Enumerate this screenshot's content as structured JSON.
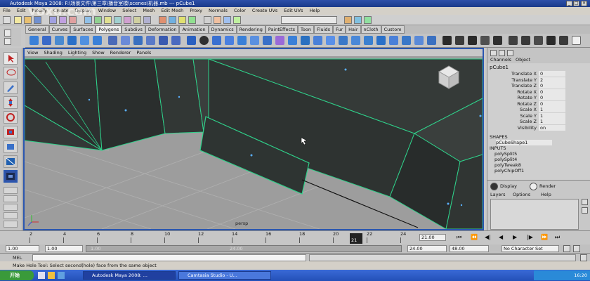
{
  "window": {
    "title": "Autodesk Maya 2008: F:\\场景文件\\第三章\\播音室模\\scenes\\机器.mb   ---   pCube1",
    "watermark": "yoxu.com"
  },
  "menubar": [
    "File",
    "Edit",
    "Modify",
    "Create",
    "Display",
    "Window",
    "Select",
    "Mesh",
    "Edit Mesh",
    "Proxy",
    "Normals",
    "Color",
    "Create UVs",
    "Edit UVs",
    "Help"
  ],
  "shelf_tabs": [
    "General",
    "Curves",
    "Surfaces",
    "Polygons",
    "Subdivs",
    "Deformation",
    "Animation",
    "Dynamics",
    "Rendering",
    "PaintEffects",
    "Toon",
    "Fluids",
    "Fur",
    "Hair",
    "nCloth",
    "Custom"
  ],
  "active_shelf_tab": "Polygons",
  "viewport": {
    "menu": [
      "View",
      "Shading",
      "Lighting",
      "Show",
      "Renderer",
      "Panels"
    ],
    "camera_label": "persp",
    "wire_color": "#2fd08a",
    "face_color": "#2f3533",
    "grid_color": "#a3a3a3"
  },
  "channel_box": {
    "header": [
      "Channels",
      "Object"
    ],
    "object_name": "pCube1",
    "attributes": [
      {
        "name": "Translate X",
        "value": "0"
      },
      {
        "name": "Translate Y",
        "value": "2"
      },
      {
        "name": "Translate Z",
        "value": "0"
      },
      {
        "name": "Rotate X",
        "value": "0"
      },
      {
        "name": "Rotate Y",
        "value": "0"
      },
      {
        "name": "Rotate Z",
        "value": "0"
      },
      {
        "name": "Scale X",
        "value": "1"
      },
      {
        "name": "Scale Y",
        "value": "1"
      },
      {
        "name": "Scale Z",
        "value": "1"
      },
      {
        "name": "Visibility",
        "value": "on"
      }
    ],
    "shapes_label": "SHAPES",
    "shape_name": "pCubeShape1",
    "inputs_label": "INPUTS",
    "inputs": [
      "polySplit5",
      "polySplit4",
      "polyTweak8",
      "polyChipOff1"
    ],
    "layer_display": "Display",
    "layer_render": "Render",
    "layer_menu": [
      "Layers",
      "Options",
      "Help"
    ]
  },
  "time_slider": {
    "ticks": [
      "2",
      "4",
      "6",
      "8",
      "10",
      "12",
      "14",
      "16",
      "18",
      "20",
      "22",
      "24"
    ],
    "current_frame": "21",
    "current_time_field": "21.00"
  },
  "range_slider": {
    "start_time": "1.00",
    "start_range": "1.00",
    "range_start_label": "1.00",
    "range_end_label": "24.00",
    "end_range": "24.00",
    "end_time": "48.00",
    "character_set": "No Character Set"
  },
  "command_line": {
    "label": "MEL"
  },
  "help_line": "Make Hole Tool: Select second(hole) face from the same object",
  "taskbar": {
    "start_label": "开始",
    "tasks": [
      "Autodesk Maya 2008: ...",
      "Camtasia Studio - U..."
    ],
    "clock": "16:20"
  }
}
